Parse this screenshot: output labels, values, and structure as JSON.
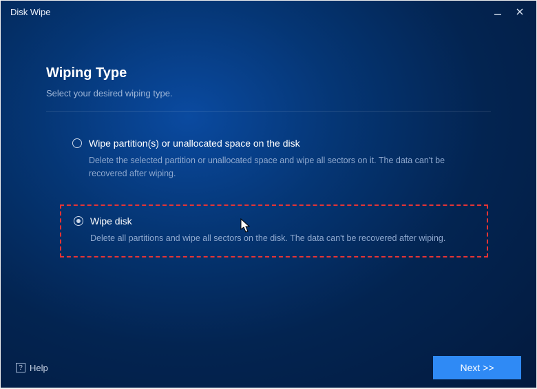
{
  "titlebar": {
    "title": "Disk Wipe"
  },
  "page": {
    "heading": "Wiping Type",
    "subtitle": "Select your desired wiping type."
  },
  "options": {
    "partition": {
      "label": "Wipe partition(s) or unallocated space on the disk",
      "desc": "Delete the selected partition or unallocated space and wipe all sectors on it. The data can't be recovered after wiping.",
      "selected": false
    },
    "disk": {
      "label": "Wipe disk",
      "desc": "Delete all partitions and wipe all sectors on the disk. The data can't be recovered after wiping.",
      "selected": true
    }
  },
  "footer": {
    "help_label": "Help",
    "next_label": "Next >>"
  }
}
